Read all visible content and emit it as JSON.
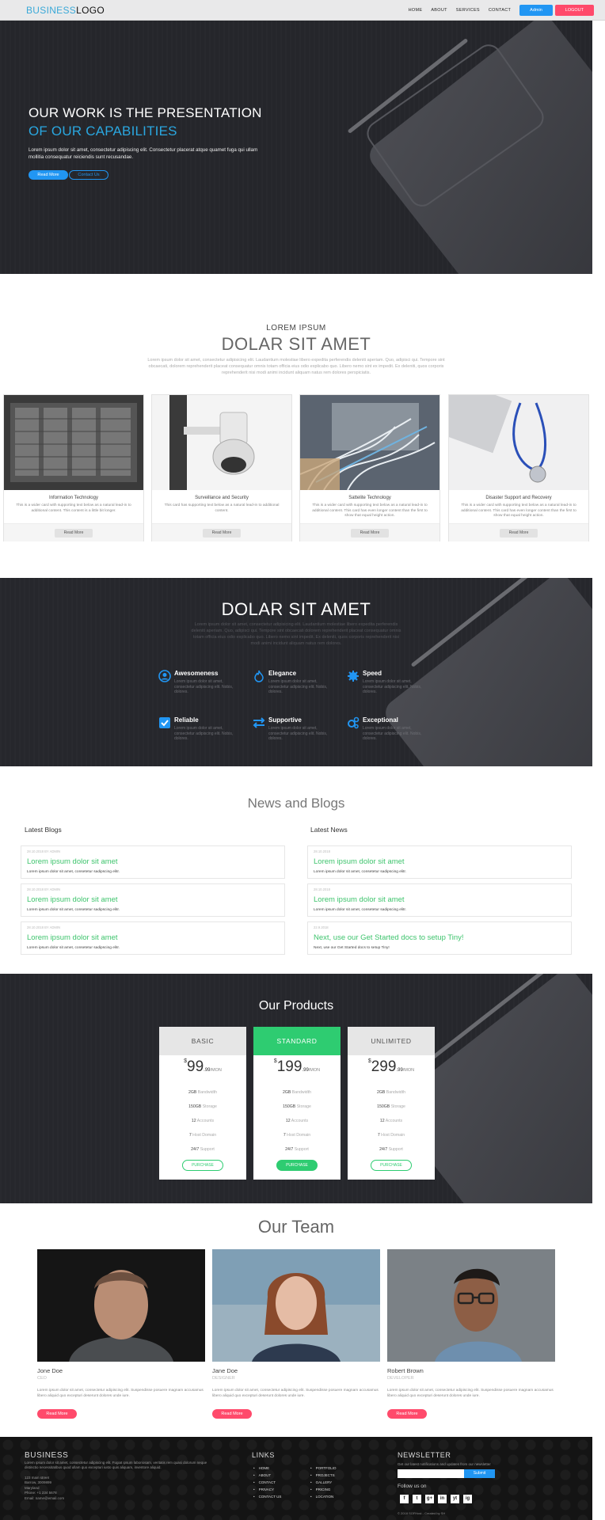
{
  "nav": {
    "logo_brand": "BUSINESS",
    "logo_word": "LOGO",
    "links": [
      "HOME",
      "ABOUT",
      "SERVICES",
      "CONTACT"
    ],
    "admin_label": "Admin",
    "logout_label": "LOGOUT"
  },
  "hero": {
    "title_line1": "OUR WORK IS THE PRESENTATION",
    "title_line2": "OF OUR CAPABILITIES",
    "text": "Lorem ipsum dolor sit amet, consectetur adipiscing elit. Consectetur placerat atque quamet fuga qui ullam mollitia consequatur reiciendis sunt recusandae.",
    "btn_primary": "Read More",
    "btn_secondary": "Contact Us"
  },
  "services": {
    "kicker": "LOREM IPSUM",
    "title": "DOLAR SIT AMET",
    "text": "Lorem ipsum dolor sit amet, consectetur adipisicing elit. Laudantium molestiae libero expedita perferendis deleniti aperiam. Quo, adipisci qui. Tempore sint obcaecati, dolorem reprehenderit placeat consequatur omnis totam officia eius odio explicabo quo. Libero nemo sint ex impedit. Ex deleniti, quos corporis reprehenderit nisi modi animi incidunt aliquam natus rem dolores perspiciatis.",
    "cards": [
      {
        "title": "Information Technology",
        "text": "This is a wider card with supporting text below as a natural lead-in to additional content. This content is a little bit longer.",
        "button": "Read More"
      },
      {
        "title": "Surveillance and Security",
        "text": "This card has supporting text below as a natural lead-in to additional content.",
        "button": "Read More"
      },
      {
        "title": "Sattelite Technology",
        "text": "This is a wider card with supporting text below as a natural lead-in to additional content. This card has even longer content than the first to show that equal height action.",
        "button": "Read More"
      },
      {
        "title": "Disaster Support and Recovery",
        "text": "This is a wider card with supporting text below as a natural lead-in to additional content. This card has even longer content than the first to show that equal height action.",
        "button": "Read More"
      }
    ]
  },
  "features": {
    "title": "DOLAR SIT AMET",
    "sub": "Lorem ipsum dolor sit amet, consectetur adipisicing elit. Laudantium molestiae libero expedita perferendis deleniti aperiam. Quo, adipisci qui. Tempore sint obcaecati dolorem reprehenderit placeat consequatur omnis totam officia eius odio explicabo quo. Libero nemo sint impedit. Ex deleniti, quos corporis reprehenderit nisi modi animi incidunt aliquam natus rem dolores.",
    "items": [
      {
        "name": "Awesomeness",
        "icon": "user-circle-icon",
        "desc": "Lorem ipsum dolor sit amet, consectetur adipiscing elit. Nobis, dolores."
      },
      {
        "name": "Elegance",
        "icon": "fire-icon",
        "desc": "Lorem ipsum dolor sit amet, consectetur adipiscing elit. Nobis, dolores."
      },
      {
        "name": "Speed",
        "icon": "gear-icon",
        "desc": "Lorem ipsum dolor sit amet, consectetur adipiscing elit. Nobis, dolores."
      },
      {
        "name": "Reliable",
        "icon": "checkbox-icon",
        "desc": "Lorem ipsum dolor sit amet, consectetur adipiscing elit. Nobis, dolores."
      },
      {
        "name": "Supportive",
        "icon": "exchange-arrows-icon",
        "desc": "Lorem ipsum dolor sit amet, consectetur adipiscing elit. Nobis, dolores."
      },
      {
        "name": "Exceptional",
        "icon": "cogs-icon",
        "desc": "Lorem ipsum dolor sit amet, consectetur adipiscing elit. Nobis, dolores."
      }
    ],
    "accent": "#2196f3"
  },
  "news": {
    "title": "News and Blogs",
    "blogs_title": "Latest Blogs",
    "news_title": "Latest News",
    "blogs": [
      {
        "meta": "28.10.2018  BY ADMIN",
        "head": "Lorem ipsum dolor sit amet",
        "body": "Lorem ipsum dolor sit amet, consetetur sadipscing elitr."
      },
      {
        "meta": "28.10.2018  BY ADMIN",
        "head": "Lorem ipsum dolor sit amet",
        "body": "Lorem ipsum dolor sit amet, consetetur sadipscing elitr."
      },
      {
        "meta": "28.10.2018  BY ADMIN",
        "head": "Lorem ipsum dolor sit amet",
        "body": "Lorem ipsum dolor sit amet, consetetur sadipscing elitr."
      }
    ],
    "news": [
      {
        "meta": "28.10.2018",
        "head": "Lorem ipsum dolor sit amet",
        "body": "Lorem ipsum dolor sit amet, consetetur sadipscing elitr."
      },
      {
        "meta": "28.10.2018",
        "head": "Lorem ipsum dolor sit amet",
        "body": "Lorem ipsum dolor sit amet, consetetur sadipscing elitr."
      },
      {
        "meta": "22.9.2018",
        "head": "Next, use our Get Started docs to setup Tiny!",
        "body": "Next, use our Get Started docs to setup Tiny!"
      }
    ],
    "accent": "#3ec46d"
  },
  "products": {
    "title": "Our Products",
    "plans": [
      {
        "name": "BASIC",
        "currency": "$",
        "price": "99",
        "cents": ".99",
        "period": "/MON",
        "features": [
          [
            "2GB",
            "Bandwidth"
          ],
          [
            "150GB",
            "Storage"
          ],
          [
            "12",
            "Accounts"
          ],
          [
            "7",
            "Host Domain"
          ],
          [
            "24/7",
            "Support"
          ]
        ],
        "button": "PURCHASE"
      },
      {
        "name": "STANDARD",
        "currency": "$",
        "price": "199",
        "cents": ".99",
        "period": "/MON",
        "features": [
          [
            "2GB",
            "Bandwidth"
          ],
          [
            "150GB",
            "Storage"
          ],
          [
            "12",
            "Accounts"
          ],
          [
            "7",
            "Host Domain"
          ],
          [
            "24/7",
            "Support"
          ]
        ],
        "button": "PURCHASE"
      },
      {
        "name": "UNLIMITED",
        "currency": "$",
        "price": "299",
        "cents": ".99",
        "period": "/MON",
        "features": [
          [
            "2GB",
            "Bandwidth"
          ],
          [
            "150GB",
            "Storage"
          ],
          [
            "12",
            "Accounts"
          ],
          [
            "7",
            "Host Domain"
          ],
          [
            "24/7",
            "Support"
          ]
        ],
        "button": "PURCHASE"
      }
    ],
    "accent": "#2ecc71"
  },
  "team": {
    "title": "Our Team",
    "members": [
      {
        "name": "Jone Doe",
        "role": "CEO",
        "bio": "Lorem ipsum dolor sit amet, consectetur adipiscing elit. Suspendisse posuere magnam accusamus libero aliquid quo excepturi deserunt dolores unde iure.",
        "button": "Read More"
      },
      {
        "name": "Jane Doe",
        "role": "DESIGNER",
        "bio": "Lorem ipsum dolor sit amet, consectetur adipiscing elit. Suspendisse posuere magnam accusamus libero aliquid quo excepturi deserunt dolores unde iure.",
        "button": "Read More"
      },
      {
        "name": "Robert Brown",
        "role": "DEVELOPER",
        "bio": "Lorem ipsum dolor sit amet, consectetur adipiscing elit. Suspendisse posuere magnam accusamus libero aliquid quo excepturi deserunt dolores unde iure.",
        "button": "Read More"
      }
    ],
    "accent": "#ff4a6b"
  },
  "footer": {
    "brand": "BUSINESS",
    "text": "Lorem ipsum dolor sit amet, consectetur adipiscing elit. Fugiat ipsum laboriosam, veritatis rem quasi dolorum neque distinctio necessitatibus quod ullam quo excepturi iusto quis aliquam, inventore aliquid.",
    "address": "123 main street\nBarrow, 3009899\nMaryland\nPhone: +1 234 5678\nEmail: name@email.com",
    "links_title": "LINKS",
    "links_col1": [
      "HOME",
      "ABOUT",
      "CONTACT",
      "PRIVACY",
      "CONTACT US"
    ],
    "links_col2": [
      "PORTFOLIO",
      "PROJECTS",
      "GALLERY",
      "PRICING",
      "LOCATION"
    ],
    "newsletter_title": "NEWSLETTER",
    "newsletter_text": "Get our latest notifications and updates from our newsletter",
    "newsletter_placeholder": "",
    "submit_label": "Submit",
    "follow_label": "Follow us on",
    "social": [
      "f",
      "t",
      "g+",
      "in",
      "yt",
      "ig"
    ],
    "copyright": "© 2018 SOFHost - Created by SH"
  }
}
